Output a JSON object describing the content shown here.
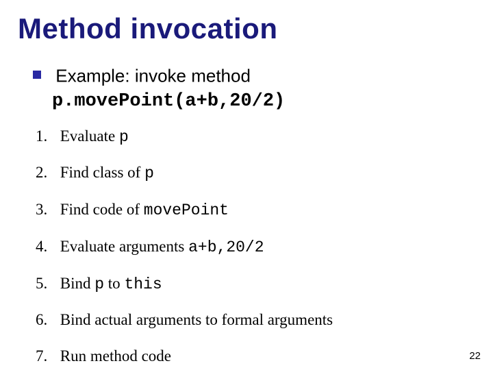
{
  "title": "Method invocation",
  "example_label": "Example:  invoke method",
  "example_code": "p.movePoint(a+b,20/2)",
  "steps": [
    {
      "num": "1.",
      "pre": "Evaluate ",
      "mono": "p",
      "post": ""
    },
    {
      "num": "2.",
      "pre": "Find class of ",
      "mono": "p",
      "post": ""
    },
    {
      "num": "3.",
      "pre": "Find code of ",
      "mono": "movePoint",
      "post": ""
    },
    {
      "num": "4.",
      "pre": "Evaluate arguments ",
      "mono": "a+b,20/2",
      "post": ""
    },
    {
      "num": "5.",
      "pre": "Bind ",
      "mono": "p",
      "post": " to ",
      "mono2": "this"
    },
    {
      "num": "6.",
      "pre": "Bind actual arguments to formal arguments",
      "mono": "",
      "post": ""
    },
    {
      "num": "7.",
      "pre": "Run method code",
      "mono": "",
      "post": ""
    }
  ],
  "page_number": "22"
}
